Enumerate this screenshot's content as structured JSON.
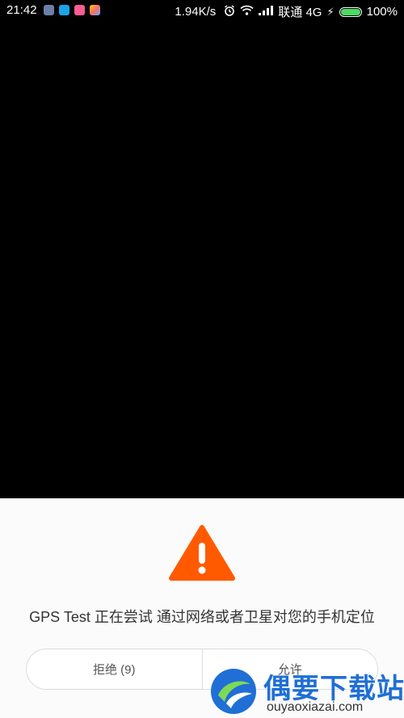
{
  "status_bar": {
    "time": "21:42",
    "speed": "1.94K/s",
    "carrier": "联通 4G",
    "battery": "100%",
    "battery_color": "#4cd964"
  },
  "dialog": {
    "icon": "warning-icon",
    "icon_color": "#ff5a00",
    "message": "GPS Test 正在尝试 通过网络或者卫星对您的手机定位",
    "deny_label": "拒绝 (9)",
    "allow_label": "允许"
  },
  "watermark": {
    "title": "偶要下载站",
    "url": "ouyaoxiazai.com",
    "color": "#1f6fd6"
  }
}
